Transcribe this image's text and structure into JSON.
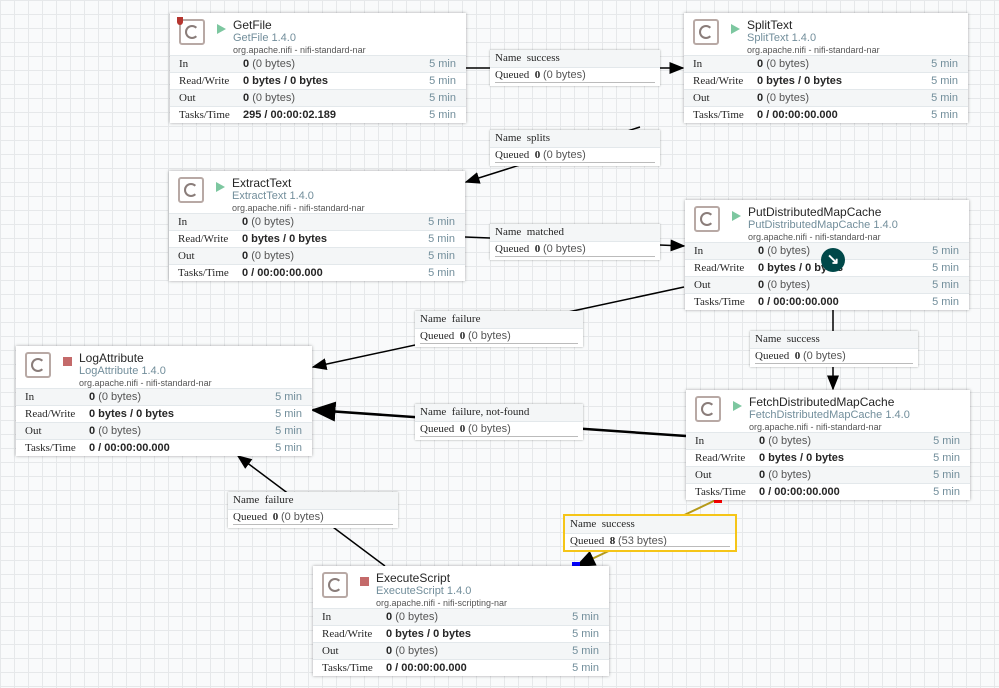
{
  "processors": [
    {
      "id": "getfile",
      "name": "GetFile",
      "type": "GetFile 1.4.0",
      "bundle": "org.apache.nifi - nifi-standard-nar",
      "state": "running",
      "invalid_badge": true,
      "in_count": "0",
      "in_size": "(0 bytes)",
      "rw": "0 bytes / 0 bytes",
      "out_count": "0",
      "out_size": "(0 bytes)",
      "tasks": "295 / 00:00:02.189",
      "window": "5 min"
    },
    {
      "id": "splittext",
      "name": "SplitText",
      "type": "SplitText 1.4.0",
      "bundle": "org.apache.nifi - nifi-standard-nar",
      "state": "running",
      "in_count": "0",
      "in_size": "(0 bytes)",
      "rw": "0 bytes / 0 bytes",
      "out_count": "0",
      "out_size": "(0 bytes)",
      "tasks": "0 / 00:00:00.000",
      "window": "5 min"
    },
    {
      "id": "extracttext",
      "name": "ExtractText",
      "type": "ExtractText 1.4.0",
      "bundle": "org.apache.nifi - nifi-standard-nar",
      "state": "running",
      "in_count": "0",
      "in_size": "(0 bytes)",
      "rw": "0 bytes / 0 bytes",
      "out_count": "0",
      "out_size": "(0 bytes)",
      "tasks": "0 / 00:00:00.000",
      "window": "5 min"
    },
    {
      "id": "putdmc",
      "name": "PutDistributedMapCache",
      "type": "PutDistributedMapCache 1.4.0",
      "bundle": "org.apache.nifi - nifi-standard-nar",
      "state": "running",
      "in_count": "0",
      "in_size": "(0 bytes)",
      "rw": "0 bytes / 0 bytes",
      "out_count": "0",
      "out_size": "(0 bytes)",
      "tasks": "0 / 00:00:00.000",
      "window": "5 min"
    },
    {
      "id": "logattribute",
      "name": "LogAttribute",
      "type": "LogAttribute 1.4.0",
      "bundle": "org.apache.nifi - nifi-standard-nar",
      "state": "stopped",
      "in_count": "0",
      "in_size": "(0 bytes)",
      "rw": "0 bytes / 0 bytes",
      "out_count": "0",
      "out_size": "(0 bytes)",
      "tasks": "0 / 00:00:00.000",
      "window": "5 min"
    },
    {
      "id": "fetchdmc",
      "name": "FetchDistributedMapCache",
      "type": "FetchDistributedMapCache 1.4.0",
      "bundle": "org.apache.nifi - nifi-standard-nar",
      "state": "running",
      "in_count": "0",
      "in_size": "(0 bytes)",
      "rw": "0 bytes / 0 bytes",
      "out_count": "0",
      "out_size": "(0 bytes)",
      "tasks": "0 / 00:00:00.000",
      "window": "5 min"
    },
    {
      "id": "executescript",
      "name": "ExecuteScript",
      "type": "ExecuteScript 1.4.0",
      "bundle": "org.apache.nifi - nifi-scripting-nar",
      "state": "stopped",
      "in_count": "0",
      "in_size": "(0 bytes)",
      "rw": "0 bytes / 0 bytes",
      "out_count": "0",
      "out_size": "(0 bytes)",
      "tasks": "0 / 00:00:00.000",
      "window": "5 min"
    }
  ],
  "row_labels": {
    "in": "In",
    "rw": "Read/Write",
    "out": "Out",
    "tasks": "Tasks/Time"
  },
  "connection_labels": {
    "name": "Name",
    "queued": "Queued"
  },
  "connections": [
    {
      "name": "success",
      "queued_count": "0",
      "queued_size": "(0 bytes)",
      "selected": false
    },
    {
      "name": "splits",
      "queued_count": "0",
      "queued_size": "(0 bytes)",
      "selected": false
    },
    {
      "name": "matched",
      "queued_count": "0",
      "queued_size": "(0 bytes)",
      "selected": false
    },
    {
      "name": "failure",
      "queued_count": "0",
      "queued_size": "(0 bytes)",
      "selected": false
    },
    {
      "name": "success",
      "queued_count": "0",
      "queued_size": "(0 bytes)",
      "selected": false
    },
    {
      "name": "failure, not-found",
      "queued_count": "0",
      "queued_size": "(0 bytes)",
      "selected": false
    },
    {
      "name": "failure",
      "queued_count": "0",
      "queued_size": "(0 bytes)",
      "selected": false
    },
    {
      "name": "success",
      "queued_count": "8",
      "queued_size": "(53 bytes)",
      "selected": true
    }
  ],
  "colors": {
    "running": "#7dc7a0",
    "stopped": "#c46a6a",
    "selection": "#f5c518",
    "source_handle": "#ff0000",
    "target_handle": "#0000ff"
  },
  "cursor_icon": "arrow-down-right-icon"
}
